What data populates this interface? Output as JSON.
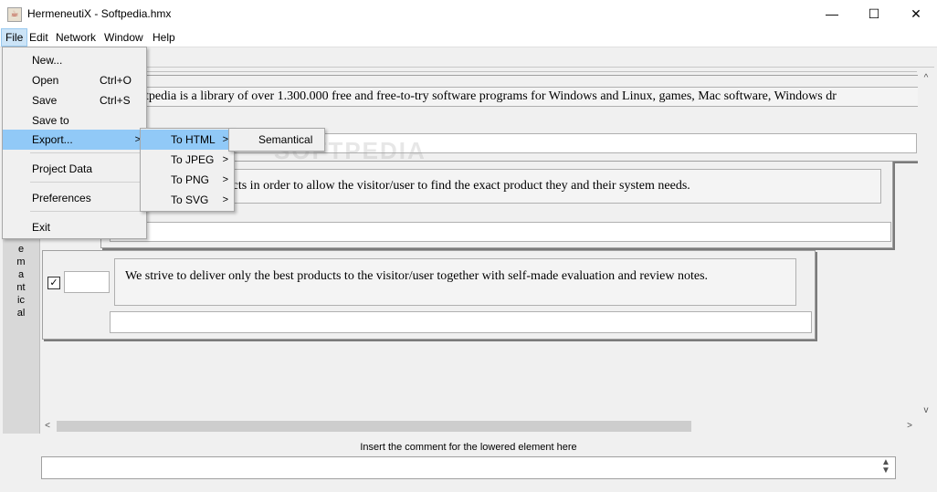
{
  "window": {
    "title": "HermeneutiX - Softpedia.hmx",
    "minimize": "—",
    "maximize": "☐",
    "close": "✕",
    "icon": "java-cup-icon"
  },
  "menubar": [
    "File",
    "Edit",
    "Network",
    "Window",
    "Help"
  ],
  "file_menu": {
    "items": [
      {
        "label": "New...",
        "accel": ""
      },
      {
        "label": "Open",
        "accel": "Ctrl+O"
      },
      {
        "label": "Save",
        "accel": "Ctrl+S"
      },
      {
        "label": "Save to",
        "accel": ""
      },
      {
        "label": "Export...",
        "accel": ""
      },
      {
        "label": "Project Data",
        "accel": ""
      },
      {
        "label": "Preferences",
        "accel": ""
      },
      {
        "label": "Exit",
        "accel": ""
      }
    ]
  },
  "export_menu": [
    "To HTML",
    "To JPEG",
    "To PNG",
    "To SVG"
  ],
  "html_menu": [
    "Semantical"
  ],
  "side_label": "emantical",
  "propositions": [
    "…tpedia is a library of over 1.300.000 free and free-to-try software programs for Windows and Linux, games, Mac software, Windows dr",
    "…egorize these products in order to allow the visitor/user to find the exact product they and their system needs.",
    "We strive to deliver only the best products to the visitor/user together with self-made evaluation and review notes."
  ],
  "comment_label": "Insert the comment for the lowered element here",
  "scroll": {
    "left": "<",
    "right": ">",
    "up": "^",
    "down": "v"
  },
  "watermark": "SOFTPEDIA"
}
